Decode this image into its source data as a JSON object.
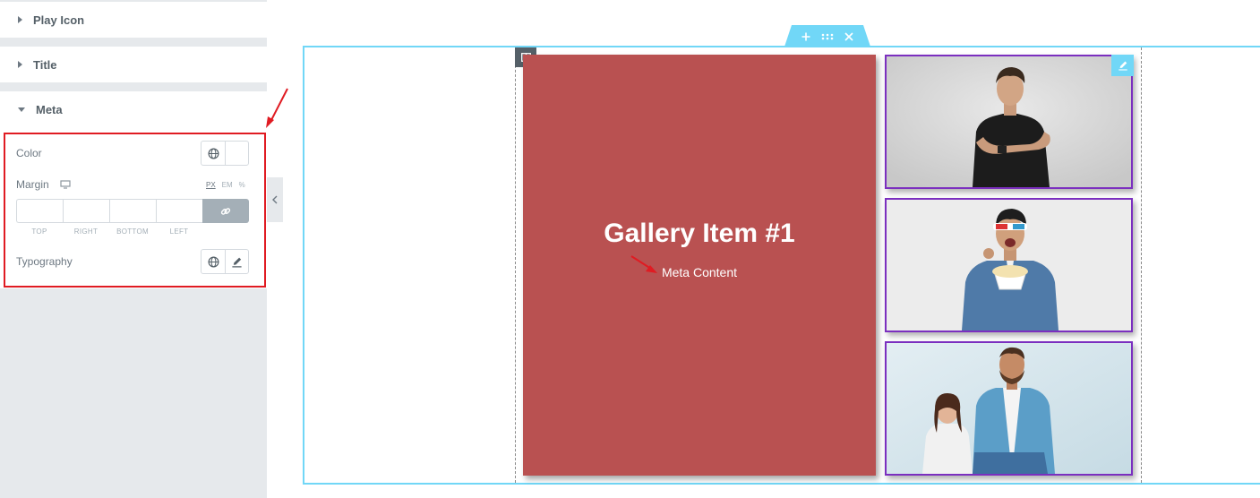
{
  "panel": {
    "sections": {
      "play_icon": "Play Icon",
      "title": "Title",
      "meta": "Meta"
    },
    "meta_controls": {
      "color_label": "Color",
      "margin_label": "Margin",
      "units": [
        "PX",
        "EM",
        "%"
      ],
      "active_unit": "PX",
      "dimension_labels": [
        "TOP",
        "RIGHT",
        "BOTTOM",
        "LEFT"
      ],
      "dimension_values": [
        "",
        "",
        "",
        ""
      ],
      "typography_label": "Typography"
    },
    "highlight_color": "#e01b22"
  },
  "canvas": {
    "gallery": {
      "featured": {
        "title": "Gallery Item #1",
        "meta": "Meta Content",
        "background": "#b95151"
      },
      "thumbnail_border": "#7b2fbf"
    },
    "editor_accent": "#71d7f7"
  }
}
